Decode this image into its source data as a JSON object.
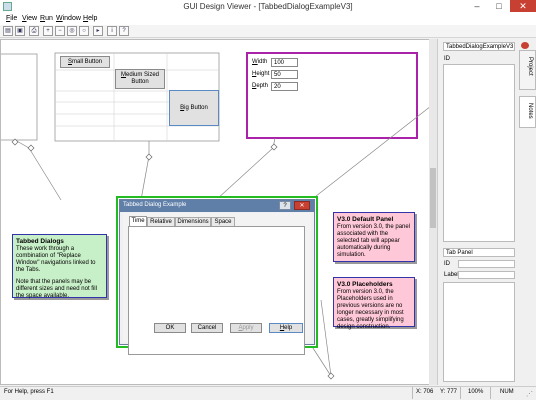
{
  "window": {
    "title": "GUI Design Viewer - [TabbedDialogExampleV3]",
    "minimize": "–",
    "maximize": "□",
    "close": "✕"
  },
  "menu": {
    "items": [
      {
        "pre": "",
        "acc": "F",
        "post": "ile"
      },
      {
        "pre": "",
        "acc": "V",
        "post": "iew"
      },
      {
        "pre": "",
        "acc": "R",
        "post": "un"
      },
      {
        "pre": "",
        "acc": "W",
        "post": "indow"
      },
      {
        "pre": "",
        "acc": "H",
        "post": "elp"
      }
    ]
  },
  "toolbar": {
    "icons": [
      "open-icon",
      "save-icon",
      "print-icon",
      "zoom-in-icon",
      "zoom-out-icon",
      "zoom-fit-icon",
      "zoom-reset-icon",
      "pointer-icon",
      "info-icon",
      "help-icon"
    ]
  },
  "canvas": {
    "buttons_group": {
      "small": {
        "pre": "",
        "acc": "S",
        "post": "mall Button"
      },
      "medium_line1": {
        "pre": "",
        "acc": "M",
        "post": "edium Sized"
      },
      "medium_line2": "Button",
      "big": {
        "pre": "",
        "acc": "B",
        "post": "ig Button"
      }
    },
    "fields_group": {
      "width_label": {
        "pre": "",
        "acc": "W",
        "post": "idth"
      },
      "height_label": {
        "pre": "",
        "acc": "H",
        "post": "eight"
      },
      "depth_label": {
        "pre": "",
        "acc": "D",
        "post": "epth"
      },
      "width_value": "100",
      "height_value": "50",
      "depth_value": "20"
    },
    "dialog": {
      "title": "Tabbed Dialog Example",
      "help_btn": "?",
      "close_btn": "✕",
      "tabs": [
        "Time",
        "Relative",
        "Dimensions",
        "Space"
      ],
      "ok": "OK",
      "cancel": "Cancel",
      "apply": {
        "pre": "",
        "acc": "A",
        "post": "pply"
      },
      "help": {
        "pre": "",
        "acc": "H",
        "post": "elp"
      }
    },
    "note_tabbed": {
      "heading": "Tabbed Dialogs",
      "p1": "These work through a combination of \"Replace Window\" navigations linked to the Tabs.",
      "p2": "Note that the panels may be different sizes and need not fill the space available."
    },
    "note_default_panel": {
      "heading": "V3.0 Default Panel",
      "body": "From version 3.0, the panel associated with the selected tab will appear automatically during simulation."
    },
    "note_placeholders": {
      "heading": "V3.0 Placeholders",
      "body": "From version 3.0, the Placeholders used in previous versions are no longer necessary in most cases, greatly simplifying design construction."
    }
  },
  "right_panel": {
    "title_top": "TabbedDialogExampleV3",
    "id_label": "ID",
    "title_bottom": "Tab Panel",
    "id_label2": "ID",
    "label_label": "Label"
  },
  "side_tabs": [
    "Project",
    "Notes"
  ],
  "status": {
    "left": "For Help, press F1",
    "x": "X: 706",
    "y": "Y: 777",
    "zoom": "100%",
    "num": "NUM"
  },
  "colors": {
    "accent_green": "#22bb22",
    "accent_purple": "#aa22aa",
    "note_green": "#c8f0c8",
    "note_pink": "#ffc8d8",
    "note_border_blue": "#3333aa",
    "dialog_title": "#5f7fa8"
  }
}
